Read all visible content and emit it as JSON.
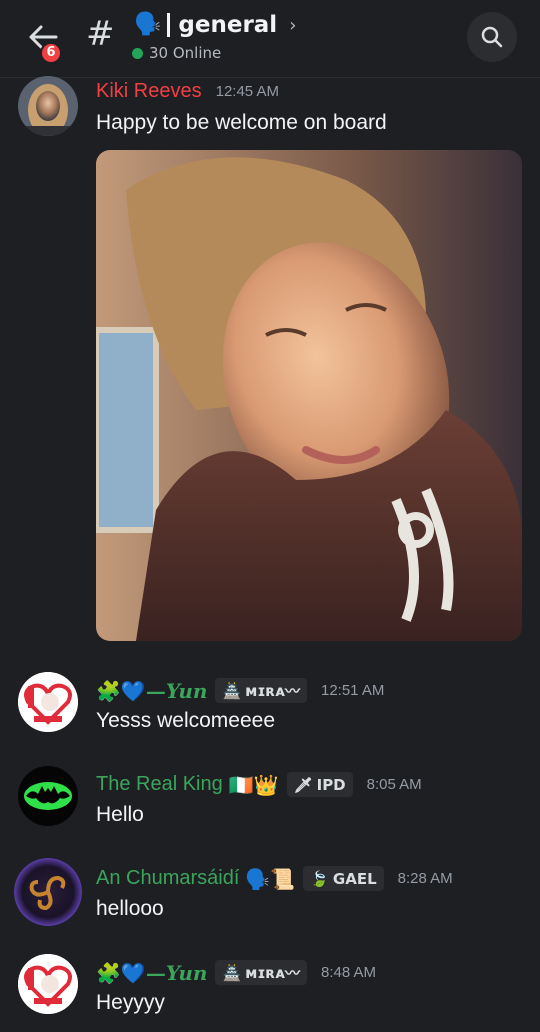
{
  "header": {
    "back_badge": "6",
    "channel_emoji": "🗣️",
    "channel_name": "general",
    "online": "30 Online"
  },
  "messages": [
    {
      "author": "Kiki Reeves",
      "author_color": "#f23f43",
      "time": "12:45 AM",
      "text": "Happy to be welcome on board",
      "has_image": true
    },
    {
      "author_prefix": "🧩💙",
      "author": "—Yun",
      "author_color": "#3ba55c",
      "tag": "ᴍɪʀᴀ〰",
      "tag_icon": "castle-icon",
      "time": "12:51 AM",
      "text": "Yesss welcomeeee"
    },
    {
      "author": "The Real King",
      "author_suffix": "🇮🇪👑",
      "author_color": "#3ba55c",
      "tag": "IPD",
      "tag_icon": "sword-icon",
      "time": "8:05 AM",
      "text": "Hello"
    },
    {
      "author": "An Chumarsáidí",
      "author_suffix": "🗣️📜",
      "author_color": "#3ba55c",
      "tag": "GAEL",
      "tag_icon": "leaf-icon",
      "time": "8:28 AM",
      "text": "hellooo"
    },
    {
      "author_prefix": "🧩💙",
      "author": "—Yun",
      "author_color": "#3ba55c",
      "tag": "ᴍɪʀᴀ〰",
      "tag_icon": "castle-icon",
      "time": "8:48 AM",
      "text": "Heyyyy"
    }
  ]
}
